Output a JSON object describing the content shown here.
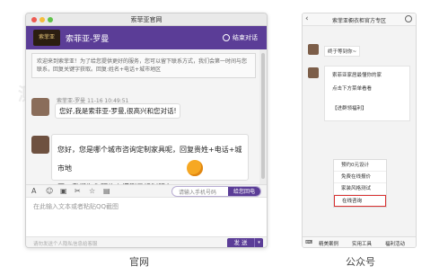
{
  "window": {
    "title": "索菲亚官网",
    "header_name": "索菲亚-罗曼",
    "end_chat": "结束对话",
    "logo_text": "索菲亚"
  },
  "chat": {
    "notice": "欢迎来到索菲亚！为了给您提供更好的服务，您可以留下联系方式，我们会第一时间与您联系，回复关键字获取。回复:姓名+电话+城市地区",
    "agent_name_time": "索菲亚-罗曼 11-16 10:49:51",
    "greeting": "您好,我是索菲亚-罗曼,很高兴和您对话!",
    "question_line1": "您好，您是哪个城市咨询定制家具呢，回复贵姓+电话+城市地",
    "question_line2": "区，我们为您预约上门测量规划服务"
  },
  "toolbar": {
    "phone_placeholder": "请输入手机号码",
    "callback_button": "给您回电"
  },
  "input": {
    "placeholder": "在此输入文本或者粘贴QQ截图",
    "footer_note": "请勿发送个人隐私信息给客服",
    "send_button": "发 送"
  },
  "captions": {
    "left": "官网",
    "right": "公众号"
  },
  "phone": {
    "title": "索菲亚橱衣柜官方专区",
    "greeting": "终于等到你~",
    "card_line1": "索菲亚家居最懂你的家",
    "card_line2": "点击下方菜单看看",
    "card_line3": "【进群领福利】",
    "menu_items": [
      "预约0元设计",
      "免费在线报价",
      "家装风格测试",
      "在线咨询"
    ],
    "tabs": [
      "精美案例",
      "实用工具",
      "福利活动"
    ]
  },
  "watermark": "测试"
}
